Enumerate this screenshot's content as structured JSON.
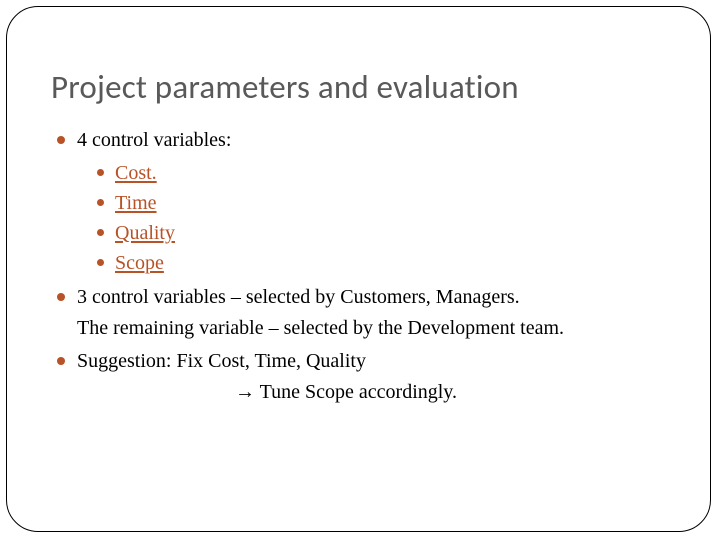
{
  "title": "Project parameters and evaluation",
  "bullets": {
    "b1": "4 control variables:",
    "sub": {
      "s1": "Cost.",
      "s2": "Time",
      "s3": "Quality",
      "s4": "Scope"
    },
    "b2_line1": "3 control variables – selected by Customers, Managers.",
    "b2_line2": "The remaining variable – selected by the Development team.",
    "b3_line1": "Suggestion: Fix Cost, Time, Quality",
    "b3_arrow": "→",
    "b3_line2": " Tune Scope accordingly."
  }
}
